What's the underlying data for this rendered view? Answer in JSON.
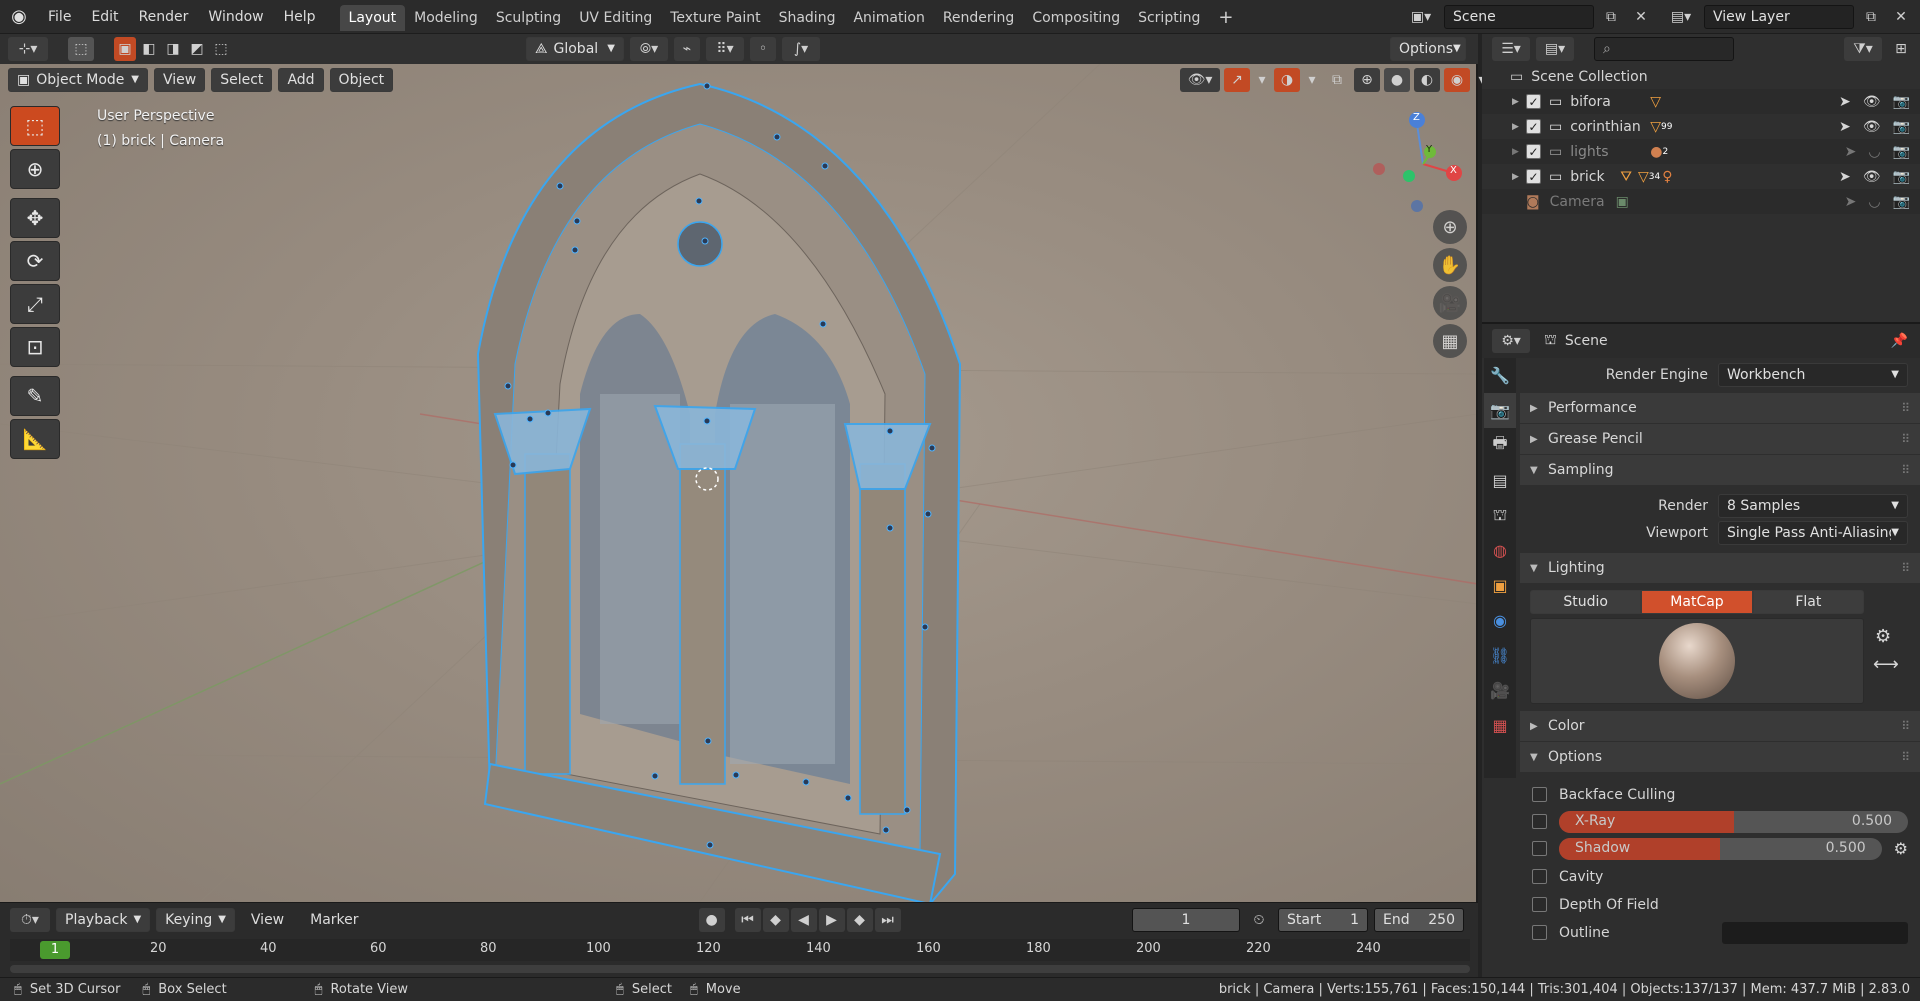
{
  "menu": {
    "items": [
      "File",
      "Edit",
      "Render",
      "Window",
      "Help"
    ]
  },
  "workspaces": {
    "tabs": [
      "Layout",
      "Modeling",
      "Sculpting",
      "UV Editing",
      "Texture Paint",
      "Shading",
      "Animation",
      "Rendering",
      "Compositing",
      "Scripting"
    ],
    "active": "Layout",
    "add_icon": "+"
  },
  "scene": {
    "name": "Scene",
    "view_layer": "View Layer"
  },
  "viewport_header": {
    "transform_orientation": "Global",
    "options_label": "Options",
    "mode": "Object Mode",
    "menus": [
      "View",
      "Select",
      "Add",
      "Object"
    ]
  },
  "viewport": {
    "perspective": "User Perspective",
    "active": "(1) brick | Camera",
    "gizmo": {
      "z": "Z",
      "y": "Y",
      "x": "X"
    }
  },
  "outliner": {
    "root": "Scene Collection",
    "items": [
      {
        "name": "bifora",
        "badge": ""
      },
      {
        "name": "corinthian",
        "badge": "99"
      },
      {
        "name": "lights",
        "badge": "2"
      },
      {
        "name": "brick",
        "badge": "34"
      },
      {
        "name": "Camera",
        "badge": ""
      }
    ]
  },
  "properties": {
    "header": "Scene",
    "render_engine_label": "Render Engine",
    "render_engine": "Workbench",
    "panels": {
      "performance": "Performance",
      "grease_pencil": "Grease Pencil",
      "sampling": "Sampling",
      "lighting": "Lighting",
      "color": "Color",
      "options": "Options"
    },
    "sampling": {
      "render_label": "Render",
      "render_value": "8 Samples",
      "viewport_label": "Viewport",
      "viewport_value": "Single Pass Anti-Aliasing"
    },
    "lighting": {
      "modes": [
        "Studio",
        "MatCap",
        "Flat"
      ],
      "active": "MatCap"
    },
    "options": {
      "backface_culling": "Backface Culling",
      "xray_label": "X-Ray",
      "xray_value": "0.500",
      "xray_level": 0.5,
      "shadow_label": "Shadow",
      "shadow_value": "0.500",
      "shadow_level": 0.5,
      "cavity": "Cavity",
      "depth_of_field": "Depth Of Field",
      "outline": "Outline"
    }
  },
  "timeline": {
    "menus": [
      "Playback",
      "Keying",
      "View",
      "Marker"
    ],
    "current_frame": "1",
    "start_label": "Start",
    "start": "1",
    "end_label": "End",
    "end": "250",
    "ruler": [
      "20",
      "40",
      "60",
      "80",
      "100",
      "120",
      "140",
      "160",
      "180",
      "200",
      "220",
      "240"
    ],
    "playhead": "1"
  },
  "statusbar": {
    "hints": [
      "Set 3D Cursor",
      "Box Select",
      "Rotate View",
      "Select",
      "Move"
    ],
    "stats": "brick | Camera | Verts:155,761 | Faces:150,144 | Tris:301,404 | Objects:137/137 | Mem: 437.7 MiB | 2.83.0"
  }
}
